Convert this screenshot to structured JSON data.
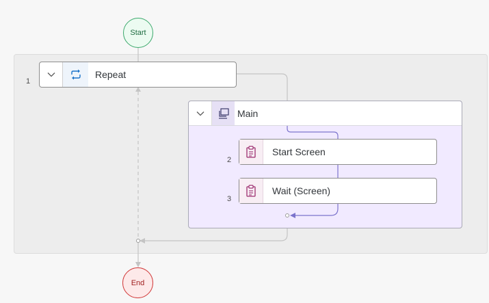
{
  "flow": {
    "start_label": "Start",
    "end_label": "End",
    "repeat": {
      "step_number": "1",
      "label": "Repeat",
      "icon": "repeat-icon"
    },
    "main": {
      "label": "Main",
      "icon": "screens-icon"
    },
    "steps": [
      {
        "number": "2",
        "label": "Start Screen",
        "icon": "clipboard-icon"
      },
      {
        "number": "3",
        "label": "Wait (Screen)",
        "icon": "clipboard-icon"
      }
    ]
  },
  "colors": {
    "start": "#3aa86b",
    "end": "#d23b3b",
    "main_background": "#f1eaff",
    "connector_active": "#7b73cc",
    "connector": "#c4c4c4",
    "step_icon": "#9b2c6e",
    "repeat_icon": "#1a73c9"
  }
}
